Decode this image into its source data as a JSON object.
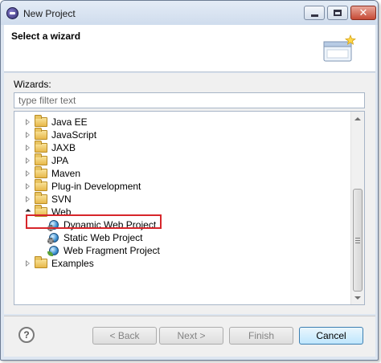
{
  "window": {
    "title": "New Project",
    "controls": {
      "minimize_icon": "minimize-icon",
      "maximize_icon": "maximize-icon",
      "close_glyph": "✕"
    }
  },
  "banner": {
    "title": "Select a wizard",
    "icon": "wizard-banner-icon"
  },
  "wizards": {
    "label": "Wizards:",
    "filter_placeholder": "type filter text",
    "filter_value": ""
  },
  "tree": {
    "items": [
      {
        "label": "Java EE",
        "expanded": false,
        "icon": "folder-icon"
      },
      {
        "label": "JavaScript",
        "expanded": false,
        "icon": "folder-icon"
      },
      {
        "label": "JAXB",
        "expanded": false,
        "icon": "folder-icon"
      },
      {
        "label": "JPA",
        "expanded": false,
        "icon": "folder-icon"
      },
      {
        "label": "Maven",
        "expanded": false,
        "icon": "folder-icon"
      },
      {
        "label": "Plug-in Development",
        "expanded": false,
        "icon": "folder-icon"
      },
      {
        "label": "SVN",
        "expanded": false,
        "icon": "folder-icon"
      },
      {
        "label": "Web",
        "expanded": true,
        "icon": "folder-icon"
      },
      {
        "label": "Dynamic Web Project",
        "icon": "dynamic-web-project-icon",
        "highlighted": true
      },
      {
        "label": "Static Web Project",
        "icon": "static-web-project-icon"
      },
      {
        "label": "Web Fragment Project",
        "icon": "web-fragment-project-icon"
      },
      {
        "label": "Examples",
        "expanded": false,
        "icon": "folder-icon"
      }
    ],
    "highlight_color": "#d7262b"
  },
  "footer": {
    "help_glyph": "?",
    "back_label": "< Back",
    "next_label": "Next >",
    "finish_label": "Finish",
    "cancel_label": "Cancel"
  }
}
